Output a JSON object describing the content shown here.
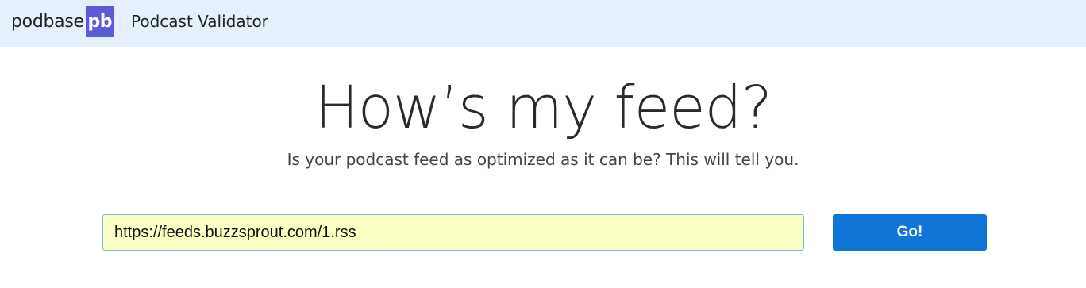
{
  "header": {
    "brand_word": "podbase",
    "brand_logo_text": "pb",
    "app_title": "Podcast Validator"
  },
  "hero": {
    "title": "How’s my feed?",
    "subtitle": "Is your podcast feed as optimized as it can be? This will tell you."
  },
  "form": {
    "feed_url_value": "https://feeds.buzzsprout.com/1.rss",
    "submit_label": "Go!"
  },
  "colors": {
    "header_bg": "#e4f0fb",
    "logo_bg": "#5b5bd6",
    "input_bg": "#fbffc3",
    "button_bg": "#0f75d6"
  }
}
